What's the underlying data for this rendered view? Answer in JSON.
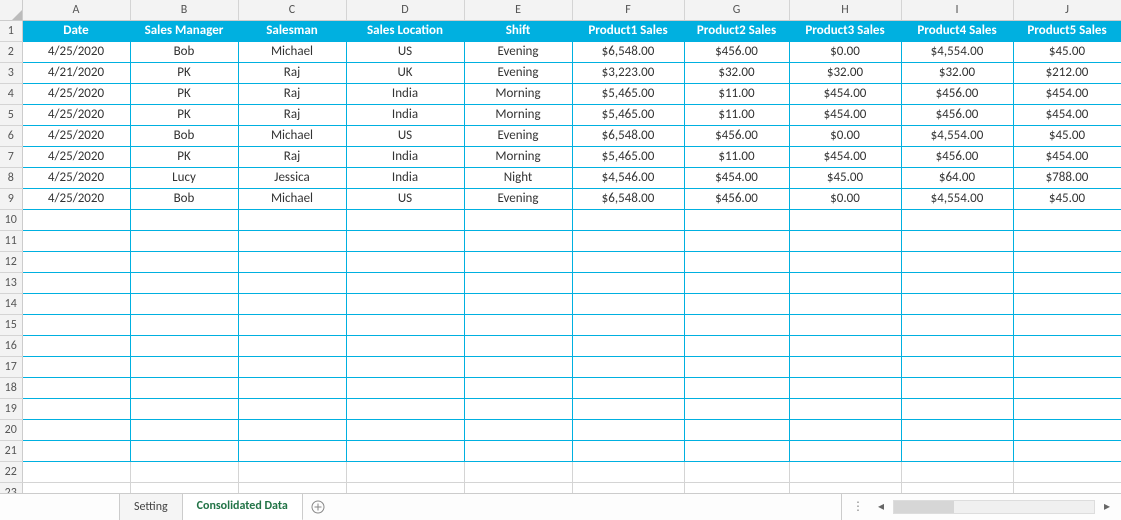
{
  "columns": [
    "A",
    "B",
    "C",
    "D",
    "E",
    "F",
    "G",
    "H",
    "I",
    "J"
  ],
  "headers": [
    "Date",
    "Sales Manager",
    "Salesman",
    "Sales Location",
    "Shift",
    "Product1 Sales",
    "Product2 Sales",
    "Product3 Sales",
    "Product4 Sales",
    "Product5 Sales"
  ],
  "rows": [
    [
      "4/25/2020",
      "Bob",
      "Michael",
      "US",
      "Evening",
      "$6,548.00",
      "$456.00",
      "$0.00",
      "$4,554.00",
      "$45.00"
    ],
    [
      "4/21/2020",
      "PK",
      "Raj",
      "UK",
      "Evening",
      "$3,223.00",
      "$32.00",
      "$32.00",
      "$32.00",
      "$212.00"
    ],
    [
      "4/25/2020",
      "PK",
      "Raj",
      "India",
      "Morning",
      "$5,465.00",
      "$11.00",
      "$454.00",
      "$456.00",
      "$454.00"
    ],
    [
      "4/25/2020",
      "PK",
      "Raj",
      "India",
      "Morning",
      "$5,465.00",
      "$11.00",
      "$454.00",
      "$456.00",
      "$454.00"
    ],
    [
      "4/25/2020",
      "Bob",
      "Michael",
      "US",
      "Evening",
      "$6,548.00",
      "$456.00",
      "$0.00",
      "$4,554.00",
      "$45.00"
    ],
    [
      "4/25/2020",
      "PK",
      "Raj",
      "India",
      "Morning",
      "$5,465.00",
      "$11.00",
      "$454.00",
      "$456.00",
      "$454.00"
    ],
    [
      "4/25/2020",
      "Lucy",
      "Jessica",
      "India",
      "Night",
      "$4,546.00",
      "$454.00",
      "$45.00",
      "$64.00",
      "$788.00"
    ],
    [
      "4/25/2020",
      "Bob",
      "Michael",
      "US",
      "Evening",
      "$6,548.00",
      "$456.00",
      "$0.00",
      "$4,554.00",
      "$45.00"
    ]
  ],
  "tabs": {
    "setting": "Setting",
    "consolidated": "Consolidated Data"
  },
  "chart_data": {
    "type": "table",
    "title": "Consolidated Sales Data",
    "columns": [
      "Date",
      "Sales Manager",
      "Salesman",
      "Sales Location",
      "Shift",
      "Product1 Sales",
      "Product2 Sales",
      "Product3 Sales",
      "Product4 Sales",
      "Product5 Sales"
    ],
    "data": [
      {
        "Date": "4/25/2020",
        "Sales Manager": "Bob",
        "Salesman": "Michael",
        "Sales Location": "US",
        "Shift": "Evening",
        "Product1 Sales": 6548,
        "Product2 Sales": 456,
        "Product3 Sales": 0,
        "Product4 Sales": 4554,
        "Product5 Sales": 45
      },
      {
        "Date": "4/21/2020",
        "Sales Manager": "PK",
        "Salesman": "Raj",
        "Sales Location": "UK",
        "Shift": "Evening",
        "Product1 Sales": 3223,
        "Product2 Sales": 32,
        "Product3 Sales": 32,
        "Product4 Sales": 32,
        "Product5 Sales": 212
      },
      {
        "Date": "4/25/2020",
        "Sales Manager": "PK",
        "Salesman": "Raj",
        "Sales Location": "India",
        "Shift": "Morning",
        "Product1 Sales": 5465,
        "Product2 Sales": 11,
        "Product3 Sales": 454,
        "Product4 Sales": 456,
        "Product5 Sales": 454
      },
      {
        "Date": "4/25/2020",
        "Sales Manager": "PK",
        "Salesman": "Raj",
        "Sales Location": "India",
        "Shift": "Morning",
        "Product1 Sales": 5465,
        "Product2 Sales": 11,
        "Product3 Sales": 454,
        "Product4 Sales": 456,
        "Product5 Sales": 454
      },
      {
        "Date": "4/25/2020",
        "Sales Manager": "Bob",
        "Salesman": "Michael",
        "Sales Location": "US",
        "Shift": "Evening",
        "Product1 Sales": 6548,
        "Product2 Sales": 456,
        "Product3 Sales": 0,
        "Product4 Sales": 4554,
        "Product5 Sales": 45
      },
      {
        "Date": "4/25/2020",
        "Sales Manager": "PK",
        "Salesman": "Raj",
        "Sales Location": "India",
        "Shift": "Morning",
        "Product1 Sales": 5465,
        "Product2 Sales": 11,
        "Product3 Sales": 454,
        "Product4 Sales": 456,
        "Product5 Sales": 454
      },
      {
        "Date": "4/25/2020",
        "Sales Manager": "Lucy",
        "Salesman": "Jessica",
        "Sales Location": "India",
        "Shift": "Night",
        "Product1 Sales": 4546,
        "Product2 Sales": 454,
        "Product3 Sales": 45,
        "Product4 Sales": 64,
        "Product5 Sales": 788
      },
      {
        "Date": "4/25/2020",
        "Sales Manager": "Bob",
        "Salesman": "Michael",
        "Sales Location": "US",
        "Shift": "Evening",
        "Product1 Sales": 6548,
        "Product2 Sales": 456,
        "Product3 Sales": 0,
        "Product4 Sales": 4554,
        "Product5 Sales": 45
      }
    ]
  }
}
